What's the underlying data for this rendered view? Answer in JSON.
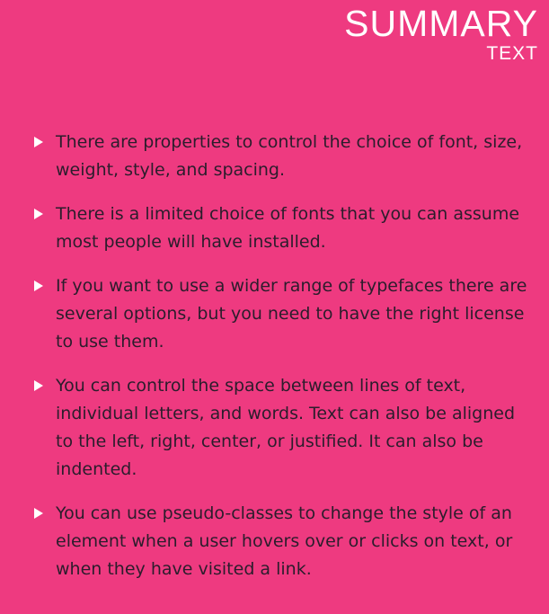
{
  "header": {
    "title": "SUMMARY",
    "subtitle": "TEXT"
  },
  "colors": {
    "background": "#ee3a80",
    "text": "#2b1d2c",
    "bullet": "#ffffff"
  },
  "bullet_icon": "triangle-right-icon",
  "items": [
    {
      "lines": [
        "There are properties to control the choice of font, size,",
        "weight, style, and spacing."
      ]
    },
    {
      "lines": [
        "There is a limited choice of fonts that you can assume",
        "most people will have installed."
      ]
    },
    {
      "lines": [
        "If you want to use a wider range of typefaces there are",
        "several options, but you need to have the right license",
        "to use them."
      ]
    },
    {
      "lines": [
        "You can control the space between lines of text,",
        "individual letters, and words. Text can also be aligned",
        "to the left, right, center, or justified. It can also be",
        "indented."
      ]
    },
    {
      "lines": [
        "You can use pseudo-classes to change the style of an",
        "element when a user hovers over or clicks on text, or",
        "when they have visited a link."
      ]
    }
  ]
}
